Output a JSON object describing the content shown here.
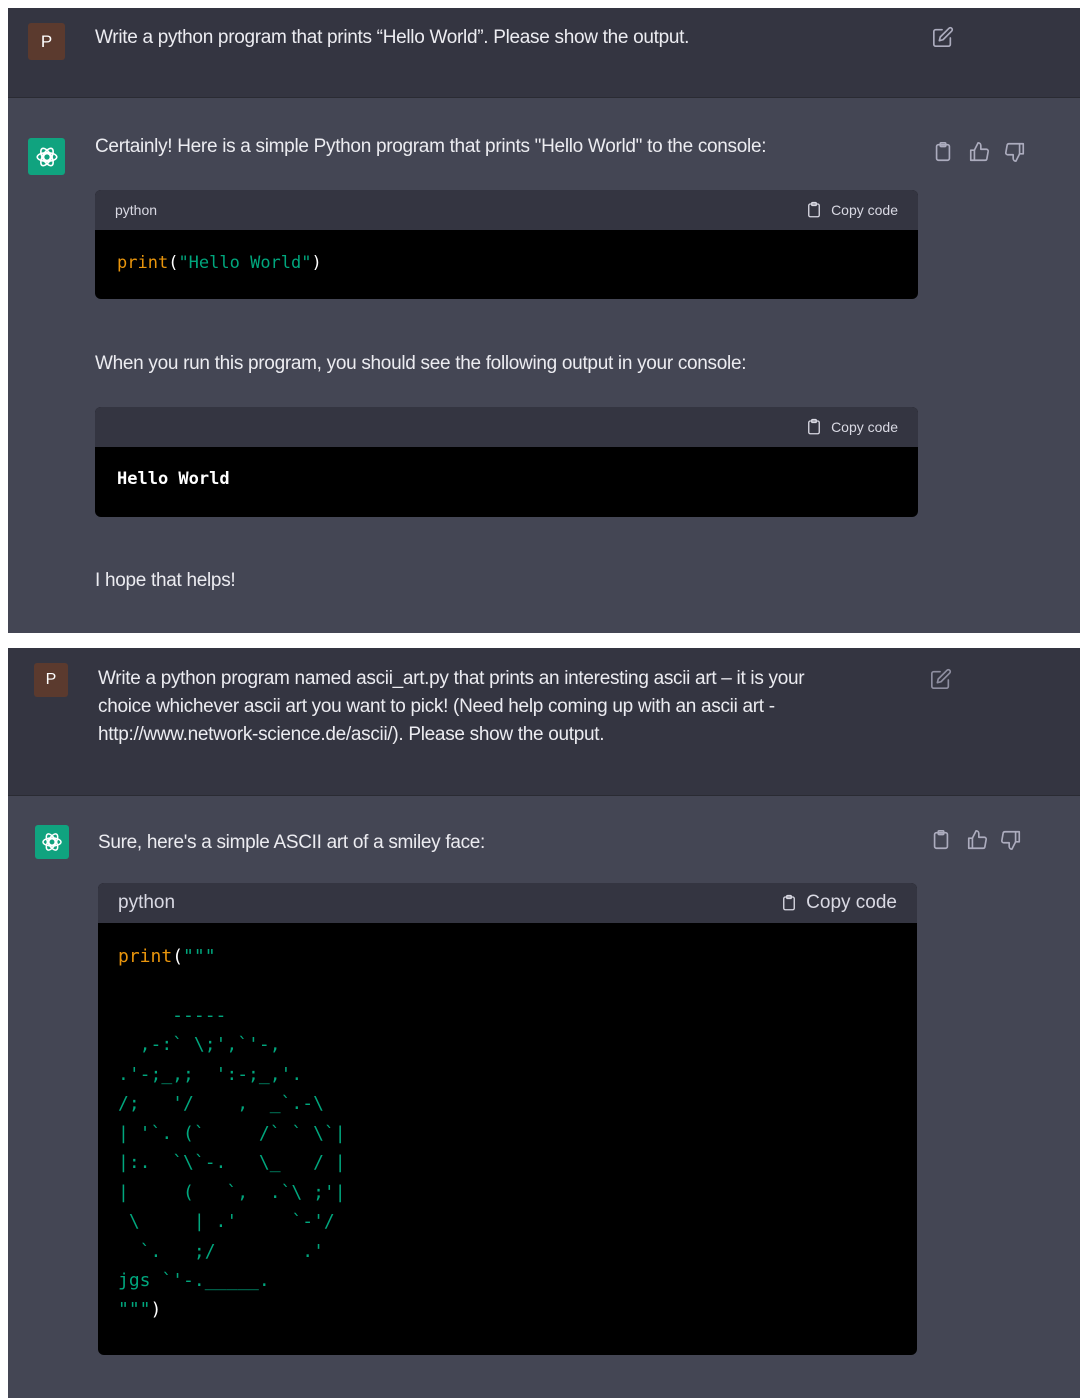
{
  "colors": {
    "user_bg": "#343541",
    "assistant_bg": "#444654",
    "code_bg": "#000000",
    "accent_green": "#10a37f",
    "string_color": "#00a67d",
    "function_color": "#e9950c"
  },
  "conversation_1": {
    "user": {
      "avatar_letter": "P",
      "message": "Write a  python program that prints “Hello World”. Please show the output."
    },
    "assistant": {
      "intro": "Certainly! Here is a simple Python program that prints \"Hello World\" to the console:",
      "code_block_1": {
        "language": "python",
        "copy_label": "Copy code",
        "fn": "print",
        "open": "(",
        "string": "\"Hello World\"",
        "close": ")"
      },
      "middle": "When you run this program, you should see the following output in your console:",
      "code_block_2": {
        "copy_label": "Copy code",
        "output": "Hello World"
      },
      "outro": "I hope that helps!"
    }
  },
  "conversation_2": {
    "user": {
      "avatar_letter": "P",
      "message_lines": [
        "Write a python program named ascii_art.py that prints an interesting ascii art – it is your",
        "choice whichever ascii art you want to pick! (Need help coming up with an ascii art -",
        "http://www.network-science.de/ascii/). Please show the output."
      ]
    },
    "assistant": {
      "intro": "Sure, here's a simple ASCII art of a smiley face:",
      "code_block": {
        "language": "python",
        "copy_label": "Copy code",
        "fn": "print",
        "open": "(",
        "open_quotes": "\"\"\"",
        "ascii_lines": [
          "",
          "     -----",
          "  ,-:` \\;',`'-,",
          ".'-;_,;  ':-;_,'.",
          "/;   '/    ,  _`.-\\",
          "| '`. (`     /` ` \\`|",
          "|:.  `\\`-.   \\_   / |",
          "|     (   `,  .`\\ ;'|",
          " \\     | .'     `-'/",
          "  `.   ;/        .'",
          "jgs `'-._____."
        ],
        "close_quotes": "\"\"\"",
        "close": ")"
      }
    }
  }
}
